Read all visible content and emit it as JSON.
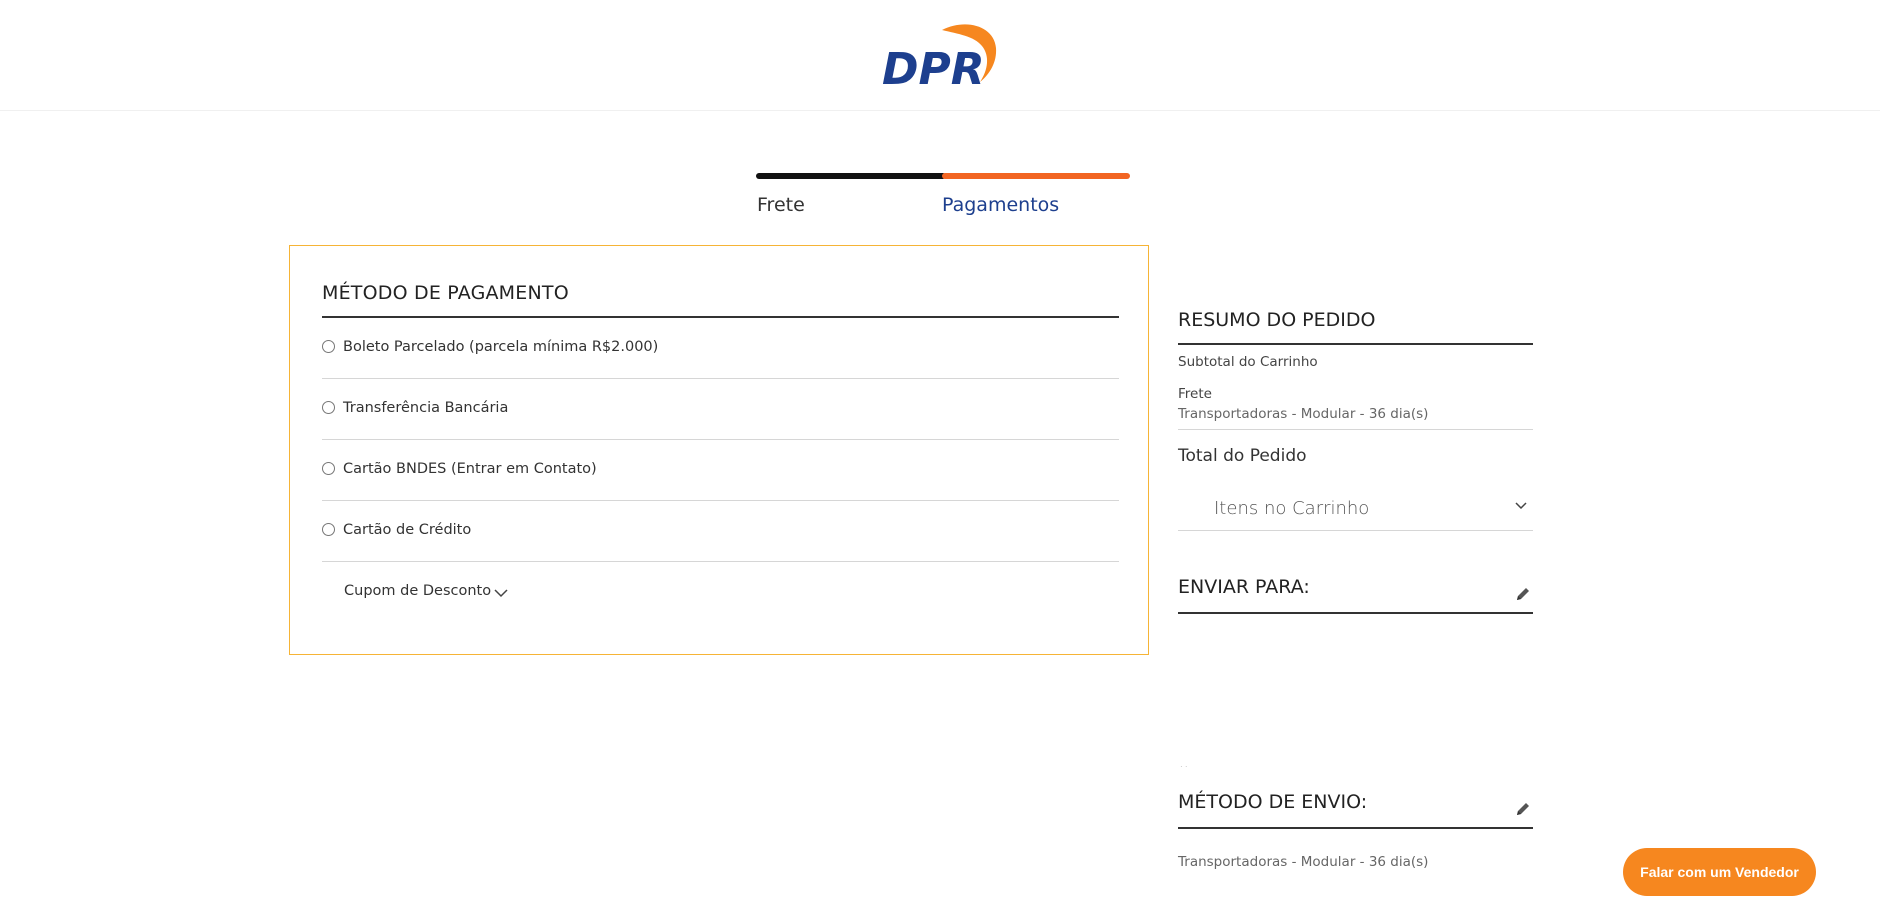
{
  "header": {
    "logo_text": "DPR"
  },
  "steps": [
    {
      "label": "Frete"
    },
    {
      "label": "Pagamentos"
    }
  ],
  "payment": {
    "title": "MÉTODO DE PAGAMENTO",
    "options": [
      {
        "label": "Boleto Parcelado (parcela mínima R$2.000)"
      },
      {
        "label": "Transferência Bancária"
      },
      {
        "label": "Cartão BNDES (Entrar em Contato)"
      },
      {
        "label": "Cartão de Crédito"
      }
    ],
    "coupon_label": "Cupom de Desconto"
  },
  "summary": {
    "title": "RESUMO DO PEDIDO",
    "subtotal_label": "Subtotal do Carrinho",
    "shipping_label": "Frete",
    "shipping_method": "Transportadoras - Modular - 36 dia(s)",
    "total_label": "Total do Pedido",
    "cart_items_label": "Itens no Carrinho"
  },
  "ship_to": {
    "title": "ENVIAR PARA:"
  },
  "ship_method": {
    "title": "MÉTODO DE ENVIO:",
    "value": "Transportadoras - Modular - 36 dia(s)"
  },
  "vendor_button": {
    "label": "Falar com um Vendedor"
  },
  "colors": {
    "accent_orange": "#f26522",
    "brand_blue": "#1d3f8e",
    "box_border": "#f6b436",
    "vendor_button": "#f6871f"
  }
}
